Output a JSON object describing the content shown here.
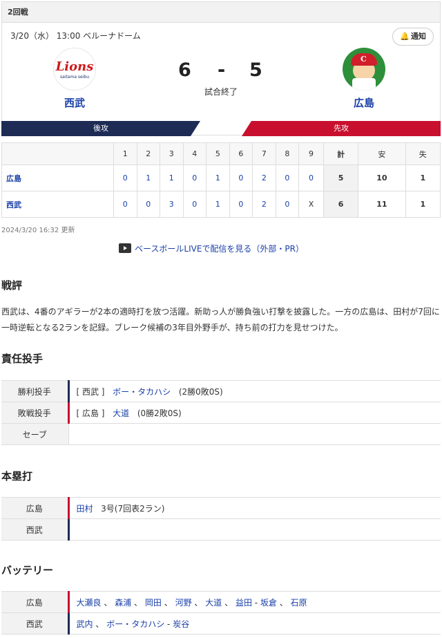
{
  "round": "2回戦",
  "meta": "3/20（水） 13:00 ベルーナドーム",
  "notify_label": "通知",
  "home": {
    "name": "西武",
    "score": "6",
    "logo_text": "Lions",
    "logo_sub": "saitama seibu"
  },
  "away": {
    "name": "広島",
    "score": "5",
    "logo_text": "C"
  },
  "separator": "-",
  "status": "試合終了",
  "home_side": "後攻",
  "away_side": "先攻",
  "innings": [
    "1",
    "2",
    "3",
    "4",
    "5",
    "6",
    "7",
    "8",
    "9"
  ],
  "hdr_total": "計",
  "hdr_hits": "安",
  "hdr_err": "失",
  "rows": [
    {
      "team": "広島",
      "runs": [
        "0",
        "1",
        "1",
        "0",
        "1",
        "0",
        "2",
        "0",
        "0"
      ],
      "total": "5",
      "hits": "10",
      "errors": "1"
    },
    {
      "team": "西武",
      "runs": [
        "0",
        "0",
        "3",
        "0",
        "1",
        "0",
        "2",
        "0",
        "X"
      ],
      "total": "6",
      "hits": "11",
      "errors": "1"
    }
  ],
  "updated": "2024/3/20 16:32 更新",
  "live_link": "ベースボールLIVEで配信を見る（外部・PR）",
  "review_title": "戦評",
  "review_text": "西武は、4番のアギラーが2本の適時打を放つ活躍。新助っ人が勝負強い打撃を披露した。一方の広島は、田村が7回に一時逆転となる2ランを記録。ブレーク候補の3年目外野手が、持ち前の打力を見せつけた。",
  "pitchers_title": "責任投手",
  "pitchers": {
    "win_label": "勝利投手",
    "win_team": "[ 西武 ]",
    "win_name": "ボー・タカハシ",
    "win_rec": "(2勝0敗0S)",
    "lose_label": "敗戦投手",
    "lose_team": "[ 広島 ]",
    "lose_name": "大道",
    "lose_rec": "(0勝2敗0S)",
    "save_label": "セーブ"
  },
  "hr_title": "本塁打",
  "hr": {
    "away_label": "広島",
    "away_name": "田村",
    "away_detail": "3号(7回表2ラン)",
    "home_label": "西武"
  },
  "battery_title": "バッテリー",
  "battery": {
    "away_label": "広島",
    "away_pitchers": [
      "大瀬良",
      "森浦",
      "岡田",
      "河野",
      "大道",
      "益田"
    ],
    "away_catchers": [
      "坂倉",
      "石原"
    ],
    "home_label": "西武",
    "home_pitchers": [
      "武内",
      "ボー・タカハシ"
    ],
    "home_catchers": [
      "炭谷"
    ],
    "sep": "、",
    "dash": "-"
  }
}
